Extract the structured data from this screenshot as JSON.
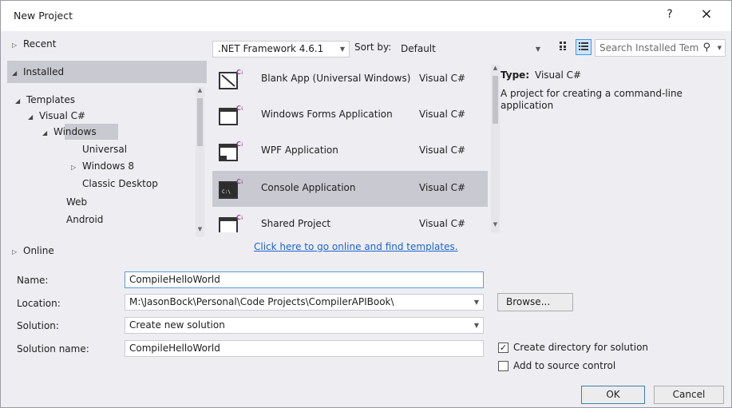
{
  "window": {
    "title": "New Project",
    "help": "?",
    "close": "×"
  },
  "tree": {
    "recent": "Recent",
    "installed": "Installed",
    "templates": "Templates",
    "visual_csharp": "Visual C#",
    "windows": "Windows",
    "universal": "Universal",
    "windows8": "Windows 8",
    "classic_desktop": "Classic Desktop",
    "web": "Web",
    "android": "Android",
    "online": "Online"
  },
  "toolbar": {
    "framework": ".NET Framework 4.6.1",
    "sort_label": "Sort by:",
    "sort_value": "Default",
    "search_placeholder": "Search Installed Tem",
    "grid_view_icon": "small-icons-view-icon",
    "list_view_icon": "list-view-icon"
  },
  "templates": [
    {
      "name": "Blank App (Universal Windows)",
      "lang": "Visual C#",
      "icon": "universal-app-icon"
    },
    {
      "name": "Windows Forms Application",
      "lang": "Visual C#",
      "icon": "winforms-icon"
    },
    {
      "name": "WPF Application",
      "lang": "Visual C#",
      "icon": "wpf-icon"
    },
    {
      "name": "Console Application",
      "lang": "Visual C#",
      "icon": "console-icon"
    },
    {
      "name": "Shared Project",
      "lang": "Visual C#",
      "icon": "shared-project-icon"
    }
  ],
  "online_link": "Click here to go online and find templates.",
  "info": {
    "type_label": "Type:",
    "type_value": "Visual C#",
    "description": "A project for creating a command-line application"
  },
  "form": {
    "name_label": "Name:",
    "name_value": "CompileHelloWorld",
    "location_label": "Location:",
    "location_value": "M:\\JasonBock\\Personal\\Code Projects\\CompilerAPIBook\\",
    "solution_label": "Solution:",
    "solution_value": "Create new solution",
    "solution_name_label": "Solution name:",
    "solution_name_value": "CompileHelloWorld",
    "browse": "Browse...",
    "create_dir": "Create directory for solution",
    "create_dir_checked": true,
    "add_source": "Add to source control",
    "add_source_checked": false,
    "ok": "OK",
    "cancel": "Cancel"
  },
  "colors": {
    "selection": "#c9c9d1",
    "link": "#1e62d0",
    "csharp_badge": "#9b4f96"
  }
}
